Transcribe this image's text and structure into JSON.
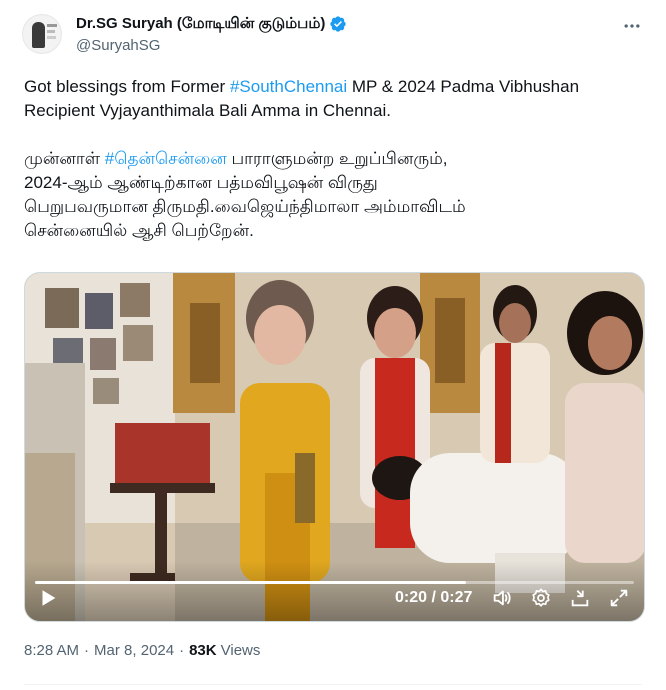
{
  "author": {
    "display_name": "Dr.SG Suryah (மோடியின் குடும்பம்)",
    "handle": "@SuryahSG",
    "verified": true
  },
  "tweet": {
    "english": {
      "part1": "Got blessings from Former ",
      "hashtag": "#SouthChennai",
      "part2": " MP & 2024 Padma Vibhushan Recipient Vyjayanthimala Bali Amma in Chennai."
    },
    "tamil": {
      "part1": "முன்னாள் ",
      "hashtag": "#தென்சென்னை",
      "part2": " பாராளுமன்ற உறுப்பினரும்,",
      "line2": "2024-ஆம் ஆண்டிற்கான பத்மவிபூஷன் விருது",
      "line3": "பெறுபவருமான திருமதி.வைஜெய்ந்திமாலா அம்மாவிடம்",
      "line4": "சென்னையில் ஆசி பெற்றேன்."
    }
  },
  "video": {
    "time": "0:20 / 0:27",
    "progress_fraction": 0.72
  },
  "meta": {
    "time": "8:28 AM",
    "date": "Mar 8, 2024",
    "views_count": "83K",
    "views_label": "Views"
  },
  "colors": {
    "link": "#1d9bf0",
    "text": "#0f1419",
    "muted": "#536471",
    "verified": "#1d9bf0"
  },
  "icons": [
    "verified-badge-icon",
    "more-icon",
    "play-icon",
    "volume-icon",
    "settings-icon",
    "share-icon",
    "fullscreen-icon"
  ]
}
